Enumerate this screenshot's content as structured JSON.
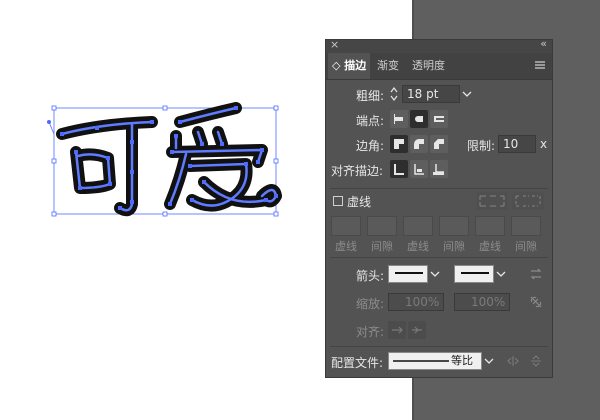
{
  "artwork": {
    "text": "可爱"
  },
  "panel": {
    "tabs": [
      {
        "label": "描边",
        "active": true
      },
      {
        "label": "渐变",
        "active": false
      },
      {
        "label": "透明度",
        "active": false
      }
    ],
    "weight": {
      "label": "粗细:",
      "value": "18 pt"
    },
    "cap": {
      "label": "端点:"
    },
    "corner": {
      "label": "边角:",
      "limit_label": "限制:",
      "limit_value": "10",
      "limit_unit": "x"
    },
    "align": {
      "label": "对齐描边:"
    },
    "dashed": {
      "label": "虚线",
      "checked": false,
      "fields": [
        "虚线",
        "间隙",
        "虚线",
        "间隙",
        "虚线",
        "间隙"
      ]
    },
    "arrow": {
      "label": "箭头:"
    },
    "scale": {
      "label": "缩放:",
      "start": "100%",
      "end": "100%"
    },
    "arrow_align": {
      "label": "对齐:"
    },
    "profile": {
      "label": "配置文件:",
      "value": "等比"
    }
  },
  "colors": {
    "panel_bg": "#535353",
    "selection": "#4f6bff",
    "canvas": "#ffffff"
  },
  "icons": [
    "close-icon",
    "collapse-icon",
    "panel-menu-icon",
    "butt-cap-icon",
    "round-cap-icon",
    "projecting-cap-icon",
    "miter-join-icon",
    "round-join-icon",
    "bevel-join-icon",
    "align-center-icon",
    "align-inside-icon",
    "align-outside-icon",
    "swap-arrows-icon",
    "link-scale-icon",
    "flip-profile-icon"
  ]
}
